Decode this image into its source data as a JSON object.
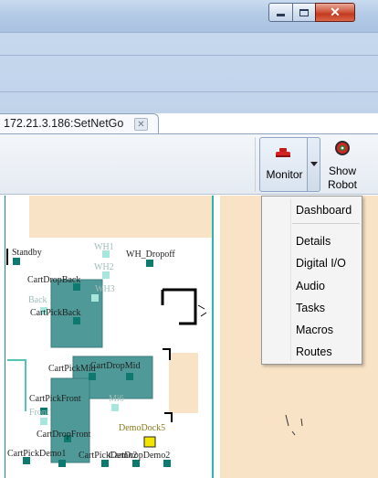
{
  "window": {
    "minimize_icon": "minimize-icon",
    "maximize_icon": "maximize-icon",
    "close_glyph": "✕"
  },
  "tab": {
    "label": "172.21.3.186:SetNetGo",
    "close_glyph": "✕"
  },
  "toolbar": {
    "monitor_label": "Monitor",
    "show_robot_line1": "Show",
    "show_robot_line2": "Robot"
  },
  "menu": {
    "items": [
      "Dashboard",
      "Details",
      "Digital I/O",
      "Audio",
      "Tasks",
      "Macros",
      "Routes"
    ]
  },
  "map": {
    "labels": {
      "standby": "Standby",
      "wh1": "WH1",
      "wh_dropoff": "WH_Dropoff",
      "wh2": "WH2",
      "cart_drop_back": "CartDropBack",
      "wh3": "WH3",
      "back": "Back",
      "cart_pick_back": "CartPickBack",
      "cart_pick_mid": "CartPickMid",
      "cart_drop_mid": "CartDropMid",
      "cart_pick_front": "CartPickFront",
      "mi6": "Mi6",
      "front": "Front",
      "demo_dock5": "DemoDock5",
      "cart_drop_front": "CartDropFront",
      "cart_pick_demo1": "CartPickDemo1",
      "cart_pick_demo2": "CartPickDemo2",
      "cart_drop_demo2": "CartDropDemo2"
    }
  },
  "colors": {
    "title_bar": "#b4cbe6",
    "zone_teal": "#4f9a98",
    "goal_square": "#0e7a6f",
    "floor_beige": "#f8e3c6",
    "wall_cyan": "#2fb3b0",
    "dock_yellow": "#f2e600"
  }
}
